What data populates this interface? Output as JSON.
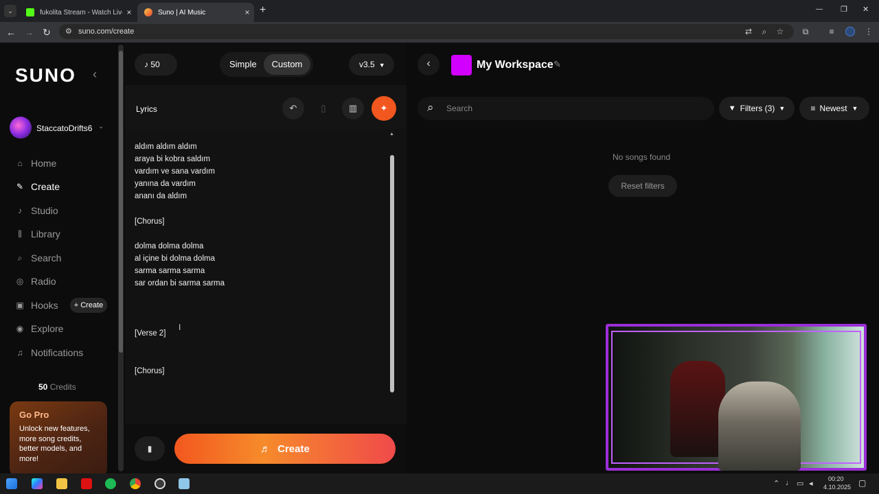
{
  "browser": {
    "tabs": [
      {
        "title": "fukolita Stream - Watch Live on",
        "close": "×"
      },
      {
        "title": "Suno | AI Music",
        "close": "×"
      }
    ],
    "new_tab": "+",
    "url": "suno.com/create",
    "window_controls": [
      "—",
      "❐",
      "✕"
    ]
  },
  "sidebar": {
    "logo": "SUNO",
    "collapse_icon": "‹",
    "username": "StaccatoDrifts6",
    "nav": [
      {
        "label": "Home",
        "icon": "home-icon"
      },
      {
        "label": "Create",
        "icon": "create-icon"
      },
      {
        "label": "Studio",
        "icon": "studio-icon"
      },
      {
        "label": "Library",
        "icon": "library-icon"
      },
      {
        "label": "Search",
        "icon": "search-icon"
      },
      {
        "label": "Radio",
        "icon": "radio-icon"
      },
      {
        "label": "Hooks",
        "icon": "hooks-icon"
      },
      {
        "label": "Explore",
        "icon": "explore-icon"
      },
      {
        "label": "Notifications",
        "icon": "bell-icon"
      }
    ],
    "hooks_create": "+ Create",
    "credits_num": "50",
    "credits_label": "Credits",
    "gopro_title": "Go Pro",
    "gopro_desc": [
      "Unlock new features,",
      "more song credits,",
      "better models, and",
      "more!"
    ]
  },
  "editor": {
    "credits": "50",
    "mode_simple": "Simple",
    "mode_custom": "Custom",
    "active_mode": "Custom",
    "version": "v3.5",
    "lyrics_label": "Lyrics",
    "lyrics_lines": [
      "aldım aldım aldım",
      "araya bi kobra saldım",
      "vardım ve sana vardım",
      "yanına da vardım",
      "ananı da aldım",
      "",
      "[Chorus]",
      "",
      "dolma dolma dolma",
      "al içine bi dolma dolma",
      "sarma sarma sarma",
      "sar ordan bi sarma sarma",
      "",
      "",
      "",
      "[Verse 2]",
      "",
      "",
      "[Chorus]"
    ],
    "create_label": "Create"
  },
  "workspace": {
    "title": "My Workspace",
    "search_placeholder": "Search",
    "filters_label": "Filters (3)",
    "sort_label": "Newest",
    "empty_text": "No songs found",
    "reset_label": "Reset filters"
  },
  "taskbar": {
    "time": "00:20",
    "date": "4.10.2025"
  },
  "colors": {
    "accent_orange": "#f2571f",
    "workspace_swatch": "#d100ff",
    "cam_frame": "#9b2fd6"
  }
}
